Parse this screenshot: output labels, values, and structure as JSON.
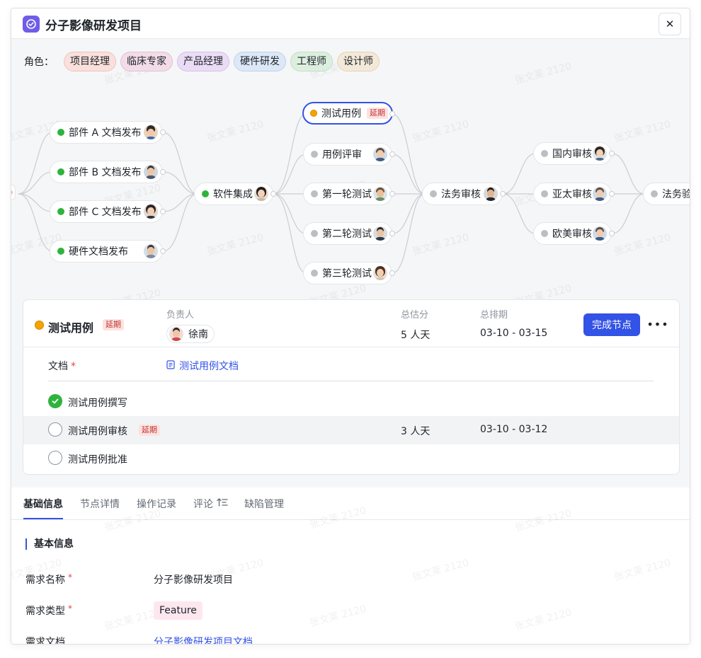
{
  "header": {
    "title": "分子影像研发项目",
    "app_icon": "check-circle-icon",
    "close_icon": "close-icon"
  },
  "roles": {
    "label": "角色：",
    "items": [
      {
        "label": "项目经理",
        "bg": "#f9e0dc",
        "border": "#efc2bb"
      },
      {
        "label": "临床专家",
        "bg": "#f2dce8",
        "border": "#e5bfd3"
      },
      {
        "label": "产品经理",
        "bg": "#eadcf5",
        "border": "#d6c1ec"
      },
      {
        "label": "硬件研发",
        "bg": "#dde8f7",
        "border": "#bdd2ef"
      },
      {
        "label": "工程师",
        "bg": "#dcefdf",
        "border": "#bfe0c4"
      },
      {
        "label": "设计师",
        "bg": "#f3e9d8",
        "border": "#e6d3b4"
      }
    ]
  },
  "flow": {
    "nodes": {
      "doc_a": {
        "label": "部件 A 文档发布"
      },
      "doc_b": {
        "label": "部件 B 文档发布"
      },
      "doc_c": {
        "label": "部件 C 文档发布"
      },
      "hw_doc": {
        "label": "硬件文档发布"
      },
      "integration": {
        "label": "软件集成"
      },
      "test_case": {
        "label": "测试用例",
        "badge": "延期"
      },
      "case_review": {
        "label": "用例评审"
      },
      "test_1": {
        "label": "第一轮测试"
      },
      "test_2": {
        "label": "第二轮测试"
      },
      "test_3": {
        "label": "第三轮测试"
      },
      "legal_review": {
        "label": "法务审核"
      },
      "domestic_review": {
        "label": "国内审核"
      },
      "apac_review": {
        "label": "亚太审核"
      },
      "eu_us_review": {
        "label": "欧美审核"
      },
      "legal_accept": {
        "label": "法务验收"
      }
    }
  },
  "detail": {
    "title": "测试用例",
    "badge": "延期",
    "owner_label": "负责人",
    "owner_name": "徐南",
    "estimate_label": "总估分",
    "estimate_value": "5 人天",
    "schedule_label": "总排期",
    "schedule_value": "03-10 - 03-15",
    "complete_button": "完成节点",
    "more_icon": "•••",
    "doc_label": "文档",
    "doc_required": "*",
    "doc_link": "测试用例文档",
    "subtasks": [
      {
        "label": "测试用例撰写",
        "done": true
      },
      {
        "label": "测试用例审核",
        "badge": "延期",
        "estimate": "3 人天",
        "schedule": "03-10 - 03-12"
      },
      {
        "label": "测试用例批准",
        "done": false
      }
    ]
  },
  "tabs": {
    "items": [
      {
        "label": "基础信息"
      },
      {
        "label": "节点详情"
      },
      {
        "label": "操作记录"
      },
      {
        "label": "评论"
      },
      {
        "label": "缺陷管理"
      }
    ],
    "active": "基础信息"
  },
  "info": {
    "section_title": "基本信息",
    "fields": {
      "name_label": "需求名称",
      "name_value": "分子影像研发项目",
      "type_label": "需求类型",
      "type_value": "Feature",
      "doc_label": "需求文档",
      "doc_value": "分子影像研发项目文档",
      "required_mark": "*"
    }
  },
  "watermark": "张文莱 2120",
  "colors": {
    "primary": "#3352e6",
    "success": "#2eb33d",
    "warning": "#f5a300",
    "danger": "#e5463d"
  }
}
